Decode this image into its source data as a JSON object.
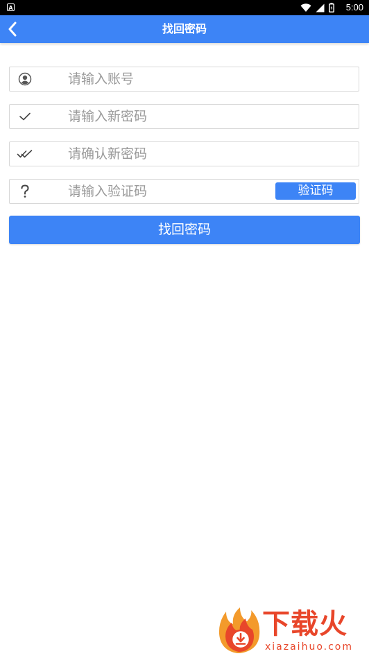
{
  "status_bar": {
    "time": "5:00",
    "app_badge": "A"
  },
  "header": {
    "title": "找回密码"
  },
  "form": {
    "account_placeholder": "请输入账号",
    "new_password_placeholder": "请输入新密码",
    "confirm_password_placeholder": "请确认新密码",
    "code_placeholder": "请输入验证码",
    "get_code_label": "验证码",
    "submit_label": "找回密码"
  },
  "watermark": {
    "brand": "下载火",
    "url": "xiazaihuo.com"
  },
  "colors": {
    "primary": "#3d84f6",
    "watermark": "#e8462a"
  },
  "icons": {
    "back": "chevron-left-icon",
    "account": "user-icon",
    "new_password": "check-icon",
    "confirm_password": "double-check-icon",
    "code": "question-icon"
  }
}
